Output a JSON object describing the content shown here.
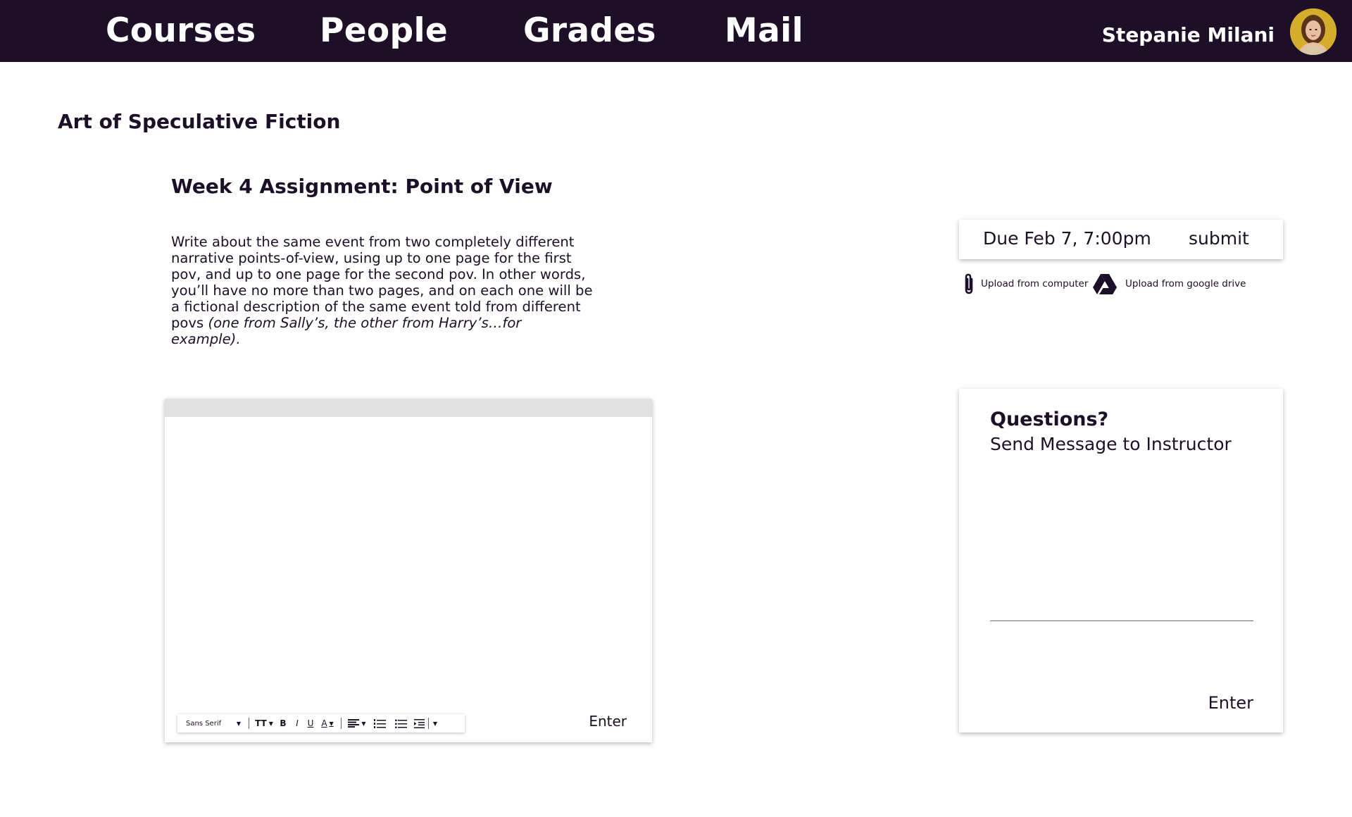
{
  "nav": {
    "items": [
      {
        "label": "Courses"
      },
      {
        "label": "People"
      },
      {
        "label": "Grades"
      },
      {
        "label": "Mail"
      }
    ],
    "user_name": "Stepanie Milani"
  },
  "course": {
    "title": "Art of Speculative Fiction"
  },
  "assignment": {
    "title": "Week 4 Assignment: Point of View",
    "description": "Write about the same event from two completely different narrative points-of-view, using up to one page for the first pov, and up to one page for the second pov. In other words, you’ll have no more than two pages, and on each one will be a fictional description of the same event told from different povs",
    "description_example": "(one from Sally’s, the other from Harry’s…for example)."
  },
  "editor": {
    "font_label": "Sans Serif",
    "text_size_label": "TT",
    "bold_label": "B",
    "italic_label": "I",
    "underline_label": "U",
    "color_label": "A",
    "enter_label": "Enter"
  },
  "due": {
    "text": "Due Feb 7, 7:00pm",
    "submit_label": "submit"
  },
  "uploads": {
    "computer_label": "Upload from computer",
    "drive_label": "Upload from google drive"
  },
  "questions": {
    "title": "Questions?",
    "subtitle": "Send Message to Instructor",
    "enter_label": "Enter"
  },
  "colors": {
    "nav_bg": "#1e0f28",
    "text": "#1c1028"
  }
}
